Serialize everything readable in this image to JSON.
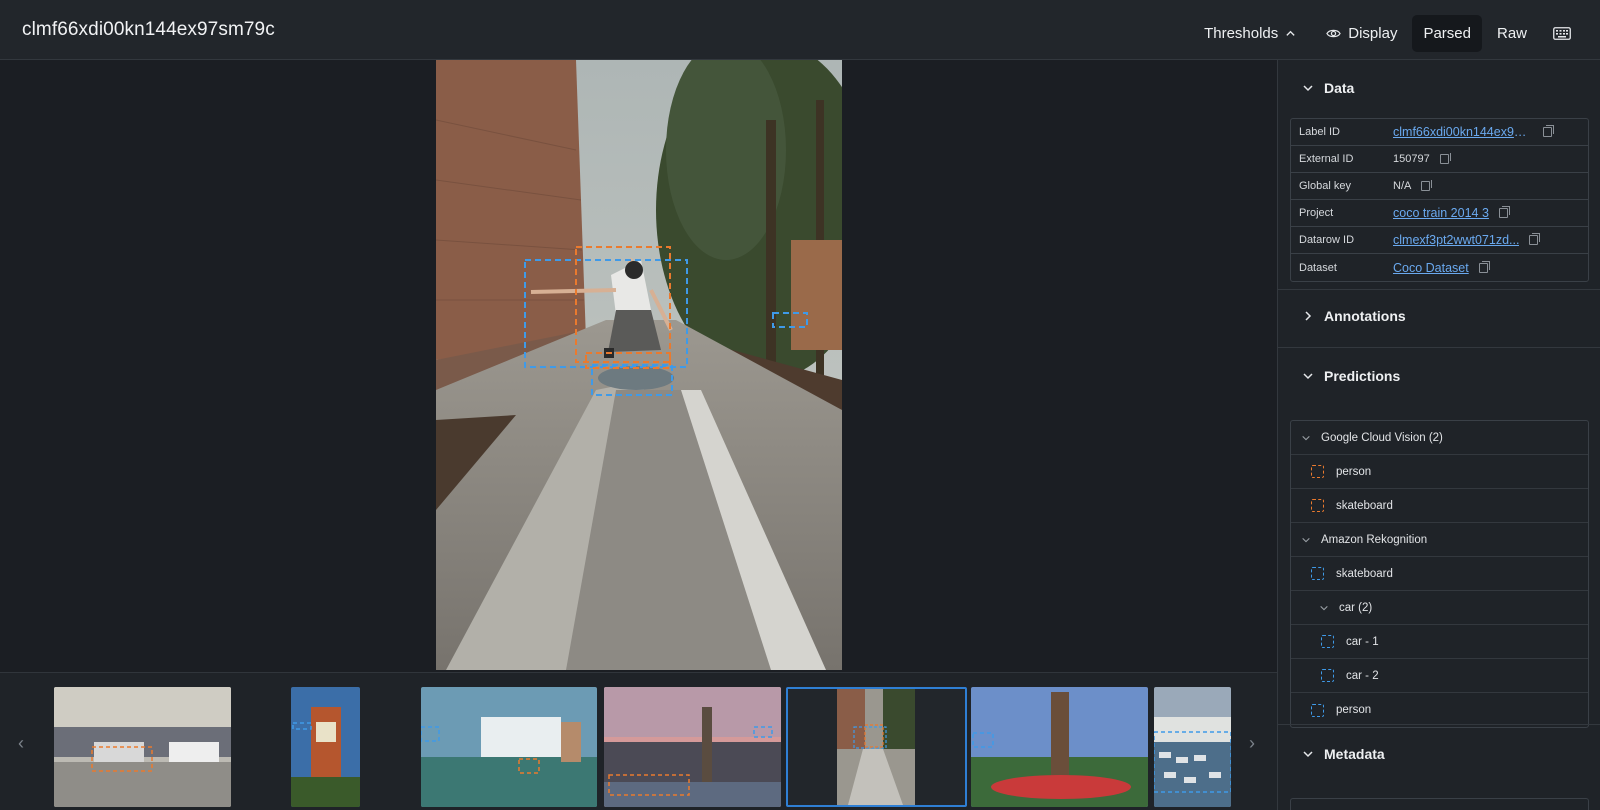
{
  "header": {
    "title": "clmf66xdi00kn144ex97sm79c",
    "thresholds_label": "Thresholds",
    "display_label": "Display",
    "parsed_label": "Parsed",
    "raw_label": "Raw"
  },
  "colors": {
    "orange_box": "#ea7a2e",
    "blue_box": "#3f9ae8",
    "link": "#6aa9ef",
    "selected_border": "#2f7fd4"
  },
  "sidebar": {
    "data": {
      "title": "Data",
      "rows": [
        {
          "key": "Label ID",
          "value": "clmf66xdi00kn144ex97sm79c",
          "link": true
        },
        {
          "key": "External ID",
          "value": "150797",
          "link": false
        },
        {
          "key": "Global key",
          "value": "N/A",
          "link": false
        },
        {
          "key": "Project",
          "value": "coco train 2014 3",
          "link": true
        },
        {
          "key": "Datarow ID",
          "value": "clmexf3pt2wwt071zd...",
          "link": true
        },
        {
          "key": "Dataset",
          "value": "Coco Dataset",
          "link": true
        }
      ]
    },
    "annotations": {
      "title": "Annotations"
    },
    "predictions": {
      "title": "Predictions",
      "groups": [
        {
          "name": "Google Cloud Vision (2)"
        },
        {
          "name": "Amazon Rekognition"
        }
      ],
      "items": {
        "gcv_person": "person",
        "gcv_skateboard": "skateboard",
        "ar_skateboard": "skateboard",
        "ar_car_group": "car (2)",
        "ar_car_1": "car - 1",
        "ar_car_2": "car - 2",
        "ar_person": "person"
      }
    },
    "metadata": {
      "title": "Metadata"
    }
  }
}
